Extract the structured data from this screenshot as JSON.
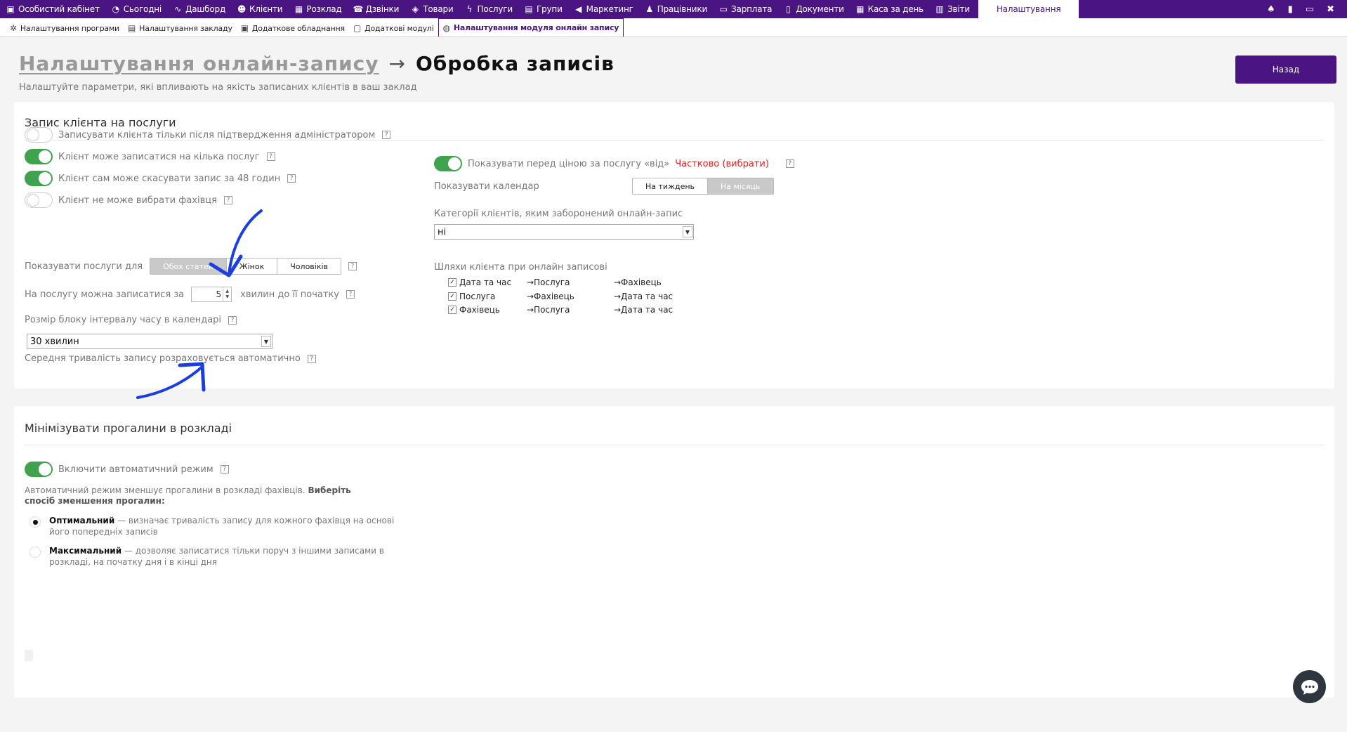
{
  "topnav": {
    "items": [
      {
        "label": "Особистий кабінет",
        "icon": "briefcase-icon",
        "glyph": "▣"
      },
      {
        "label": "Сьогодні",
        "icon": "clock-icon",
        "glyph": "◔"
      },
      {
        "label": "Дашборд",
        "icon": "pulse-icon",
        "glyph": "∿"
      },
      {
        "label": "Клієнти",
        "icon": "user-circle-icon",
        "glyph": "☻"
      },
      {
        "label": "Розклад",
        "icon": "calendar-icon",
        "glyph": "▦"
      },
      {
        "label": "Дзвінки",
        "icon": "phone-book-icon",
        "glyph": "☎"
      },
      {
        "label": "Товари",
        "icon": "box-icon",
        "glyph": "◈"
      },
      {
        "label": "Послуги",
        "icon": "bolt-icon",
        "glyph": "ϟ"
      },
      {
        "label": "Групи",
        "icon": "groups-icon",
        "glyph": "▤"
      },
      {
        "label": "Маркетинг",
        "icon": "megaphone-icon",
        "glyph": "◀"
      },
      {
        "label": "Працівники",
        "icon": "person-icon",
        "glyph": "♟"
      },
      {
        "label": "Зарплата",
        "icon": "money-icon",
        "glyph": "▭"
      },
      {
        "label": "Документи",
        "icon": "document-icon",
        "glyph": "▯"
      },
      {
        "label": "Каса за день",
        "icon": "calculator-icon",
        "glyph": "▦"
      },
      {
        "label": "Звіти",
        "icon": "bar-chart-icon",
        "glyph": "▥"
      }
    ],
    "active": "Налаштування",
    "right_icons": [
      {
        "name": "bell-icon",
        "glyph": "♠"
      },
      {
        "name": "lock-icon",
        "glyph": "▮"
      },
      {
        "name": "window-restore-icon",
        "glyph": "▭"
      },
      {
        "name": "close-window-icon",
        "glyph": "✖"
      }
    ]
  },
  "subtabs": [
    {
      "label": "Налаштування програми",
      "icon": "gear-icon",
      "glyph": "✲"
    },
    {
      "label": "Налаштування закладу",
      "icon": "building-icon",
      "glyph": "▤"
    },
    {
      "label": "Додаткове обладнання",
      "icon": "printer-icon",
      "glyph": "▣"
    },
    {
      "label": "Додаткові модулі",
      "icon": "modules-icon",
      "glyph": "▢"
    },
    {
      "label": "Налаштування модуля онлайн запису",
      "icon": "globe-icon",
      "glyph": "◍",
      "active": true
    }
  ],
  "header": {
    "crumb": "Налаштування онлайн-запису",
    "arrow": "→",
    "current": "Обробка записів",
    "subtitle": "Налаштуйте параметри, які впливають на якість записаних клієнтів в ваш заклад",
    "back_label": "Назад"
  },
  "help_glyph": "?",
  "section1": {
    "title": "Запис клієнта на послуги",
    "toggles": [
      {
        "label": "Записувати клієнта тільки після підтвердження адміністратором",
        "on": false
      },
      {
        "label": "Клієнт може записатися на кілька послуг",
        "on": true
      },
      {
        "label": "Клієнт сам може скасувати запис за 48 годин",
        "on": true
      },
      {
        "label": "Клієнт не може вибрати фахівця",
        "on": false
      }
    ],
    "show_services": {
      "label": "Показувати послуги для",
      "options": [
        "Обох статей",
        "Жінок",
        "Чоловіків"
      ],
      "selected": 0
    },
    "minutes": {
      "label_before": "На послугу можна записатися за",
      "value": "5",
      "label_after": "хвилин до її початку"
    },
    "block_size": {
      "label": "Розмір блоку інтервалу часу в календарі",
      "value": "30 хвилин"
    },
    "avg_text": "Середня тривалість запису розраховується автоматично",
    "price_from": {
      "label": "Показувати перед ціною за послугу «від»",
      "link": "Частково (вибрати)",
      "on": true
    },
    "calendar": {
      "label": "Показувати календар",
      "options": [
        "На тиждень",
        "На місяць"
      ],
      "selected": 1
    },
    "categories": {
      "label": "Категорії клієнтів, яким заборонений онлайн-запис",
      "value": "ні"
    },
    "paths": {
      "label": "Шляхи клієнта при онлайн записові",
      "rows": [
        [
          "Дата та час",
          "→Послуга",
          "→Фахівець"
        ],
        [
          "Послуга",
          "→Фахівець",
          "→Дата та час"
        ],
        [
          "Фахівець",
          "→Послуга",
          "→Дата та час"
        ]
      ],
      "check_glyph": "✓"
    }
  },
  "section2": {
    "title": "Мінімізувати прогалини в розкладі",
    "toggle": {
      "label": "Включити автоматичний режим",
      "on": true
    },
    "desc": "Автоматичний режим зменшує прогалини в розкладі фахівців.",
    "desc_bold": "Виберіть спосіб зменшення прогалин:",
    "options": [
      {
        "title": "Оптимальний",
        "text": " — визначає тривалість запису для кожного фахівця на основі його попередніх записів",
        "selected": true
      },
      {
        "title": "Максимальний",
        "text": " — дозволяє записатися тільки поруч з іншими записами в розкладі, на початку дня і в кінці дня",
        "selected": false
      }
    ]
  },
  "colors": {
    "brand": "#4a1583",
    "toggle_on": "#3fa34d",
    "link_red": "#e02020",
    "annotation_arrow": "#1a3fe0"
  }
}
